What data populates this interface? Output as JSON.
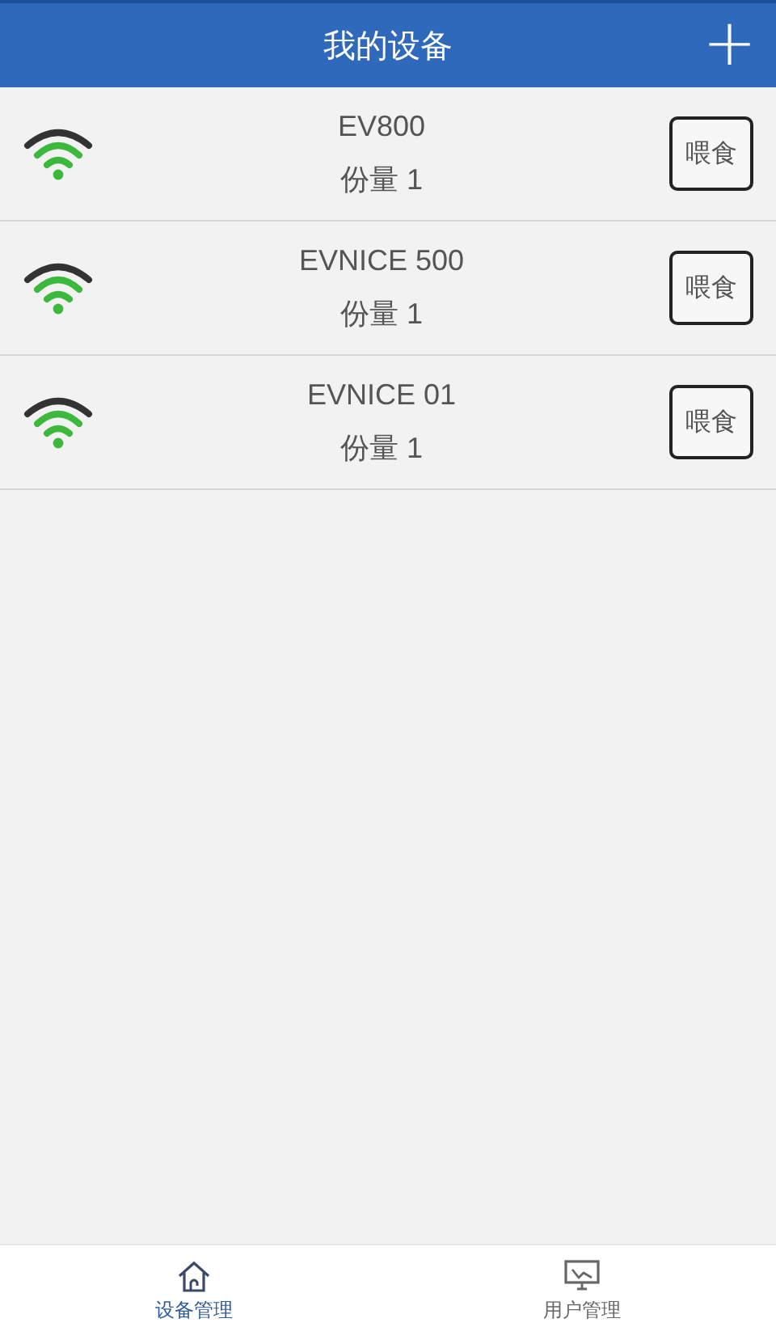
{
  "header": {
    "title": "我的设备",
    "add_button": "+"
  },
  "devices": [
    {
      "name": "EV800",
      "portion": "份量 1",
      "action": "喂食"
    },
    {
      "name": "EVNICE 500",
      "portion": "份量 1",
      "action": "喂食"
    },
    {
      "name": "EVNICE 01",
      "portion": "份量 1",
      "action": "喂食"
    }
  ],
  "tab_bar": [
    {
      "label": "设备管理",
      "selected": true
    },
    {
      "label": "用户管理",
      "selected": false
    }
  ]
}
